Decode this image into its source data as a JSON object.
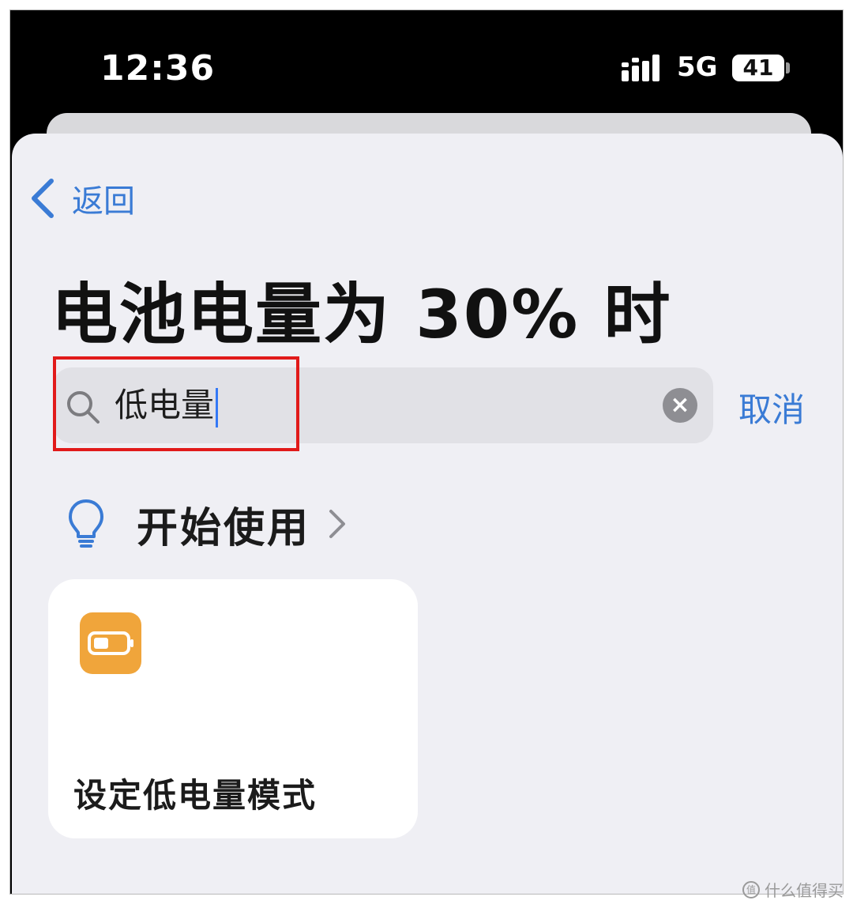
{
  "status_bar": {
    "time": "12:36",
    "network": "5G",
    "battery_level": "41"
  },
  "nav": {
    "back_label": "返回"
  },
  "page": {
    "title": "电池电量为 30% 时"
  },
  "search": {
    "value": "低电量",
    "cancel_label": "取消"
  },
  "get_started": {
    "label": "开始使用"
  },
  "action_card": {
    "label": "设定低电量模式"
  },
  "watermark": {
    "text": "什么值得买"
  },
  "colors": {
    "accent": "#3a7bd5",
    "action_icon_bg": "#f0a53b",
    "highlight": "#e11a1a",
    "sheet_bg": "#efeff4"
  }
}
